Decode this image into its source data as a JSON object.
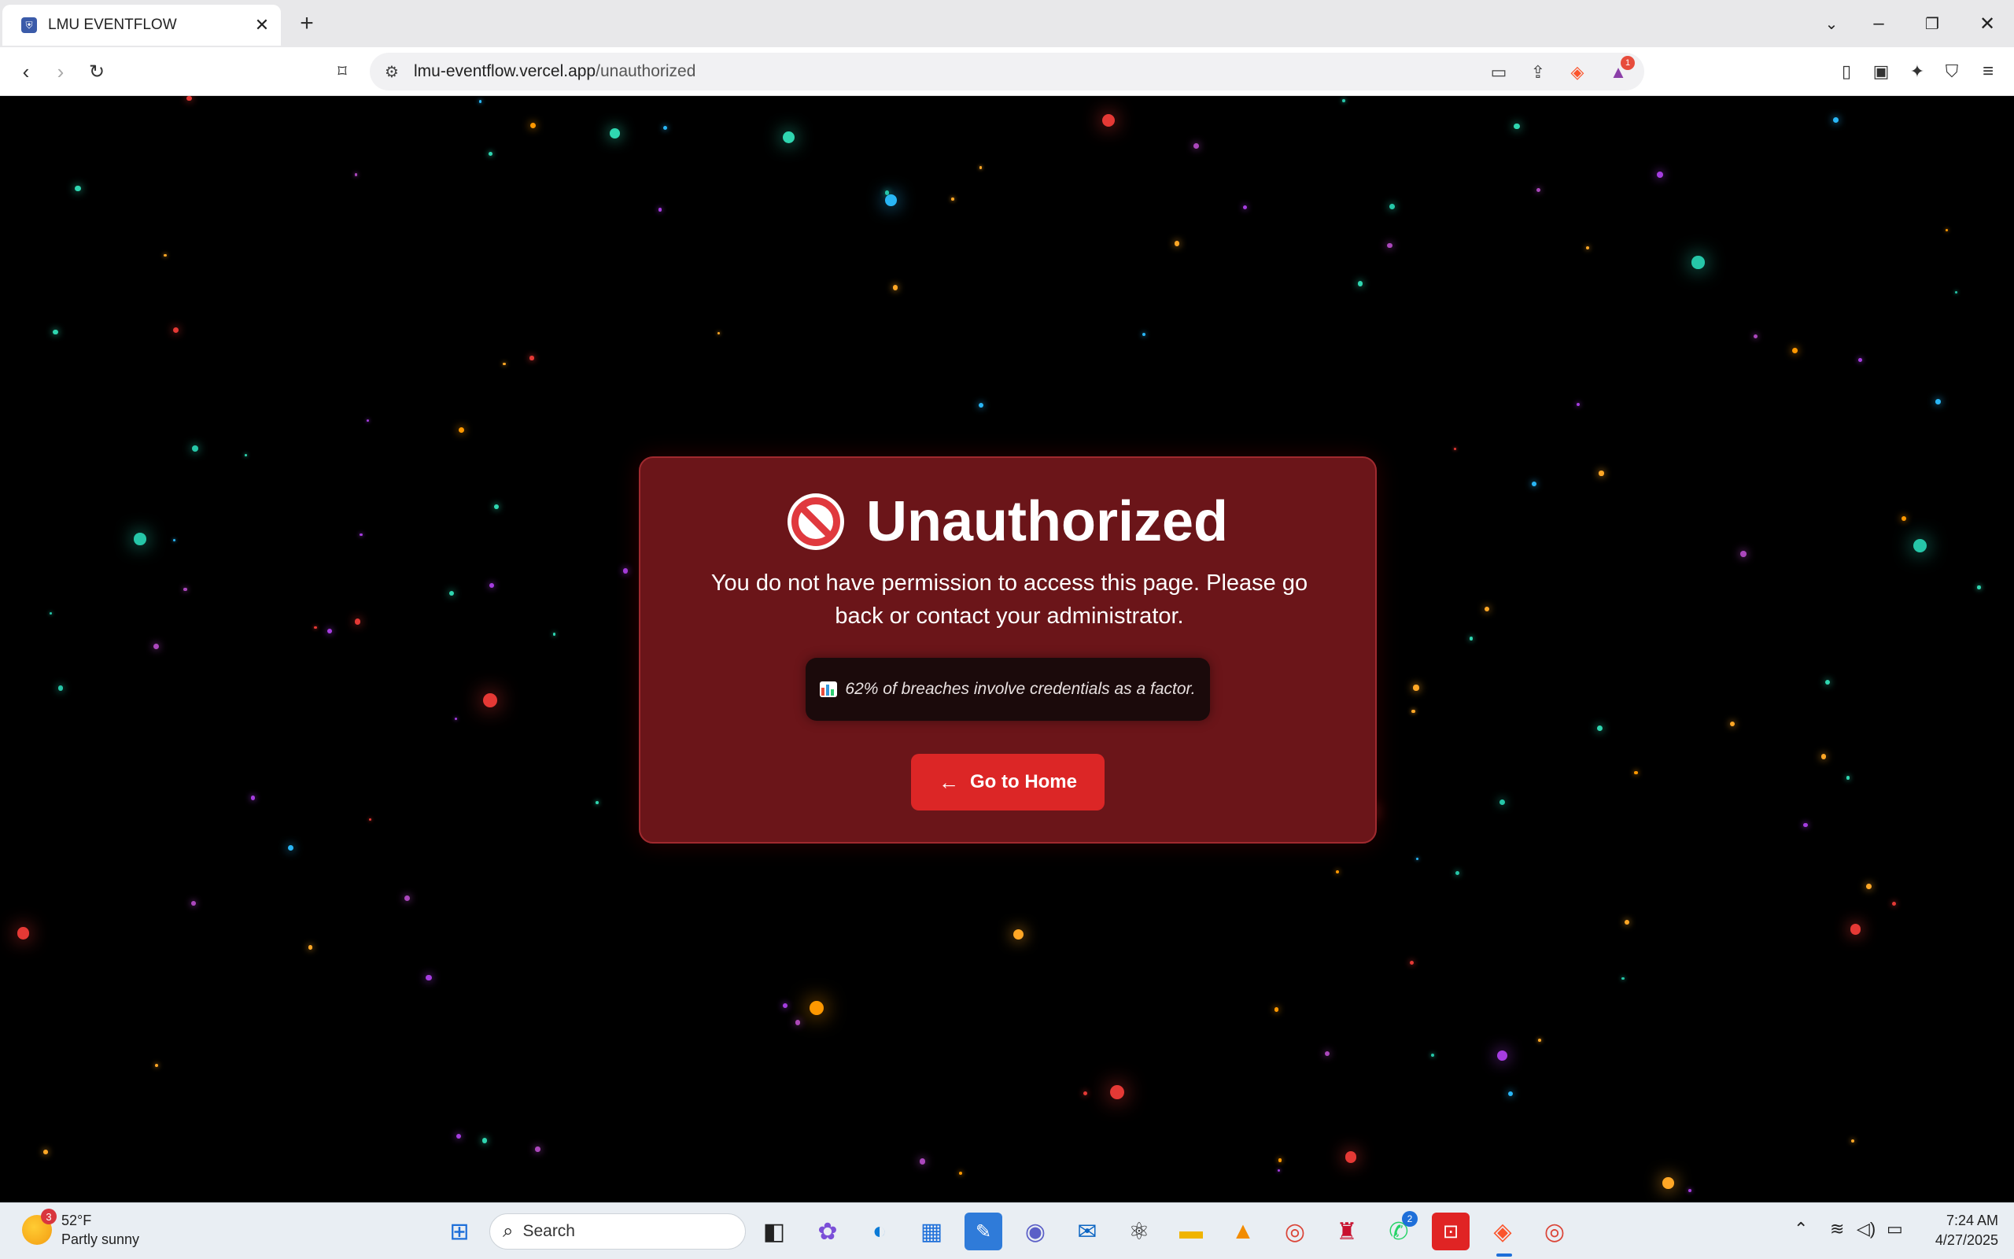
{
  "browser": {
    "tab_title": "LMU EVENTFLOW",
    "tab_close": "✕",
    "new_tab": "+",
    "url_host": "lmu-eventflow.vercel.app",
    "url_path": "/unauthorized",
    "rewards_count": "1"
  },
  "page": {
    "title": "Unauthorized",
    "message": "You do not have permission to access this page. Please go back or contact your administrator.",
    "fact": "62% of breaches involve credentials as a factor.",
    "home_button": "Go to Home",
    "accent": "#dc2626",
    "card_bg": "#6b1519"
  },
  "taskbar": {
    "weather_temp": "52°F",
    "weather_desc": "Partly sunny",
    "weather_badge": "3",
    "search_placeholder": "Search",
    "whatsapp_badge": "2",
    "time": "7:24 AM",
    "date": "4/27/2025"
  }
}
